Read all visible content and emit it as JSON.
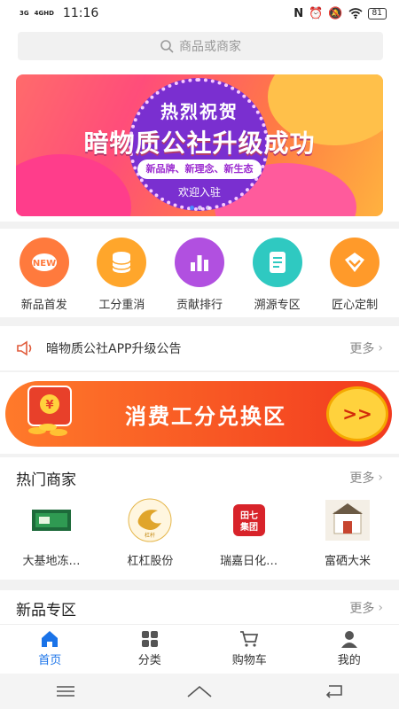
{
  "status_bar": {
    "signal_1": "3G",
    "signal_2": "4GHD",
    "time": "11:16",
    "battery": "81",
    "icons": [
      "nfc-icon",
      "alarm-icon",
      "mute-icon",
      "wifi-icon",
      "battery-icon"
    ]
  },
  "search": {
    "placeholder": "商品或商家"
  },
  "banner": {
    "line1": "热烈祝贺",
    "line2": "暗物质公社升级成功",
    "line3": "新品牌、新理念、新生态",
    "line4": "欢迎入驻"
  },
  "categories": [
    {
      "label": "新品首发",
      "icon": "new-badge-icon",
      "color": "#ff7a3d"
    },
    {
      "label": "工分重消",
      "icon": "coin-stack-icon",
      "color": "#ffa62b"
    },
    {
      "label": "贡献排行",
      "icon": "bar-chart-icon",
      "color": "#b150e0"
    },
    {
      "label": "溯源专区",
      "icon": "document-icon",
      "color": "#2fc9c1"
    },
    {
      "label": "匠心定制",
      "icon": "chevron-badge-icon",
      "color": "#ff9a2a"
    }
  ],
  "notice": {
    "text": "暗物质公社APP升级公告",
    "more": "更多"
  },
  "exchange": {
    "title": "消费工分兑换区",
    "button": ">>"
  },
  "hot_merchants": {
    "title": "热门商家",
    "more": "更多",
    "items": [
      {
        "name": "大基地冻…"
      },
      {
        "name": "杠杠股份",
        "logo_text": "杠杆"
      },
      {
        "name": "瑞嘉日化…",
        "logo_text": "田七 集团"
      },
      {
        "name": "富硒大米"
      }
    ]
  },
  "new_zone": {
    "title": "新品专区",
    "more": "更多"
  },
  "tabbar": {
    "items": [
      {
        "label": "首页",
        "icon": "home-icon"
      },
      {
        "label": "分类",
        "icon": "grid-icon"
      },
      {
        "label": "购物车",
        "icon": "cart-icon"
      },
      {
        "label": "我的",
        "icon": "user-icon"
      }
    ]
  },
  "colors": {
    "accent": "#1a73e8",
    "orange": "#f23a1f",
    "gold": "#ffd23d"
  }
}
